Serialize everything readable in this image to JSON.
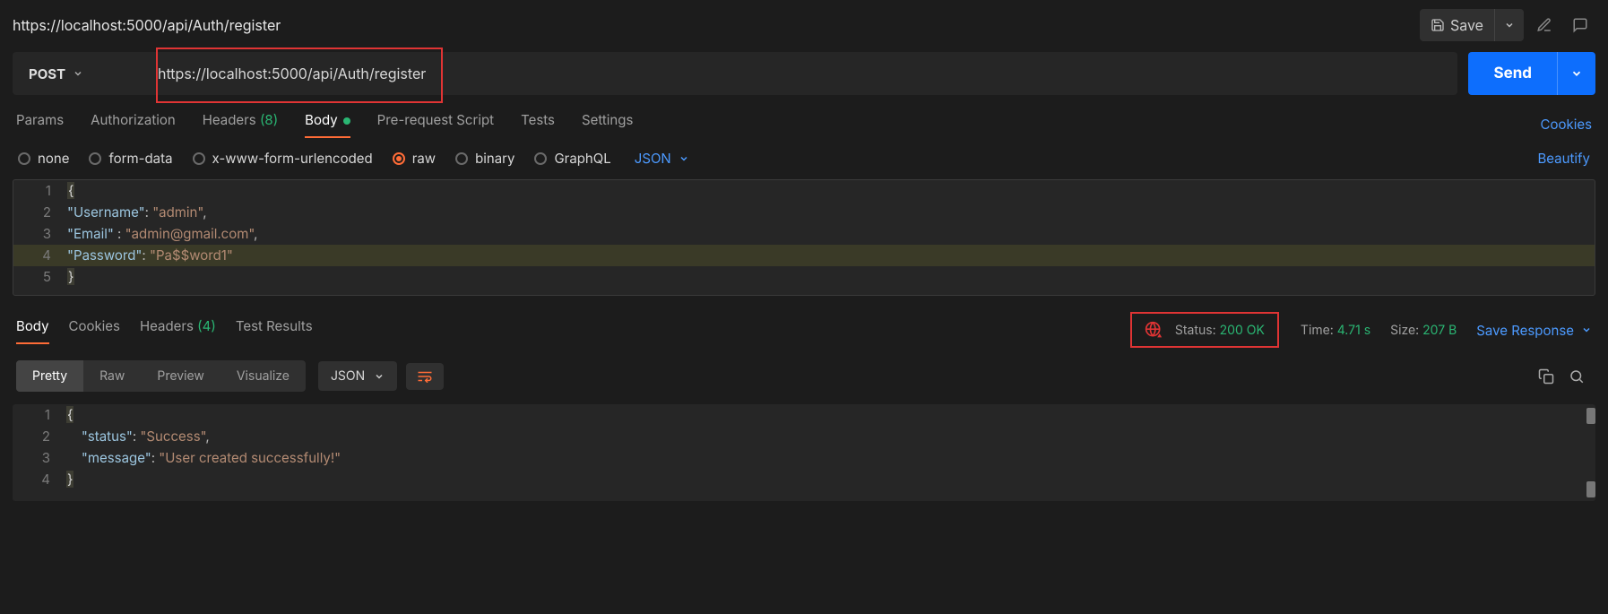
{
  "header": {
    "title": "https://localhost:5000/api/Auth/register",
    "save_label": "Save"
  },
  "request": {
    "method": "POST",
    "url": "https://localhost:5000/api/Auth/register",
    "send_label": "Send"
  },
  "tabs": {
    "params": "Params",
    "authorization": "Authorization",
    "headers": "Headers",
    "headers_count": "(8)",
    "body": "Body",
    "prerequest": "Pre-request Script",
    "tests": "Tests",
    "settings": "Settings",
    "cookies": "Cookies"
  },
  "body_types": {
    "none": "none",
    "formdata": "form-data",
    "xwww": "x-www-form-urlencoded",
    "raw": "raw",
    "binary": "binary",
    "graphql": "GraphQL",
    "lang": "JSON",
    "beautify": "Beautify"
  },
  "request_body": {
    "l1_brace": "{",
    "l2_key": "\"Username\"",
    "l2_val": "\"admin\"",
    "l3_key": "\"Email\"",
    "l3_val": "\"admin@gmail.com\"",
    "l4_key": "\"Password\"",
    "l4_val": "\"Pa$$word1\"",
    "l5_brace": "}",
    "gutter": {
      "n1": "1",
      "n2": "2",
      "n3": "3",
      "n4": "4",
      "n5": "5"
    }
  },
  "response_tabs": {
    "body": "Body",
    "cookies": "Cookies",
    "headers": "Headers",
    "headers_count": "(4)",
    "test_results": "Test Results"
  },
  "response_meta": {
    "status_label": "Status:",
    "status_value": "200 OK",
    "time_label": "Time:",
    "time_value": "4.71 s",
    "size_label": "Size:",
    "size_value": "207 B",
    "save_response": "Save Response"
  },
  "view_modes": {
    "pretty": "Pretty",
    "raw": "Raw",
    "preview": "Preview",
    "visualize": "Visualize",
    "lang": "JSON"
  },
  "response_body": {
    "l1_brace": "{",
    "l2_key": "\"status\"",
    "l2_val": "\"Success\"",
    "l3_key": "\"message\"",
    "l3_val": "\"User created successfully!\"",
    "l4_brace": "}",
    "gutter": {
      "n1": "1",
      "n2": "2",
      "n3": "3",
      "n4": "4"
    }
  }
}
